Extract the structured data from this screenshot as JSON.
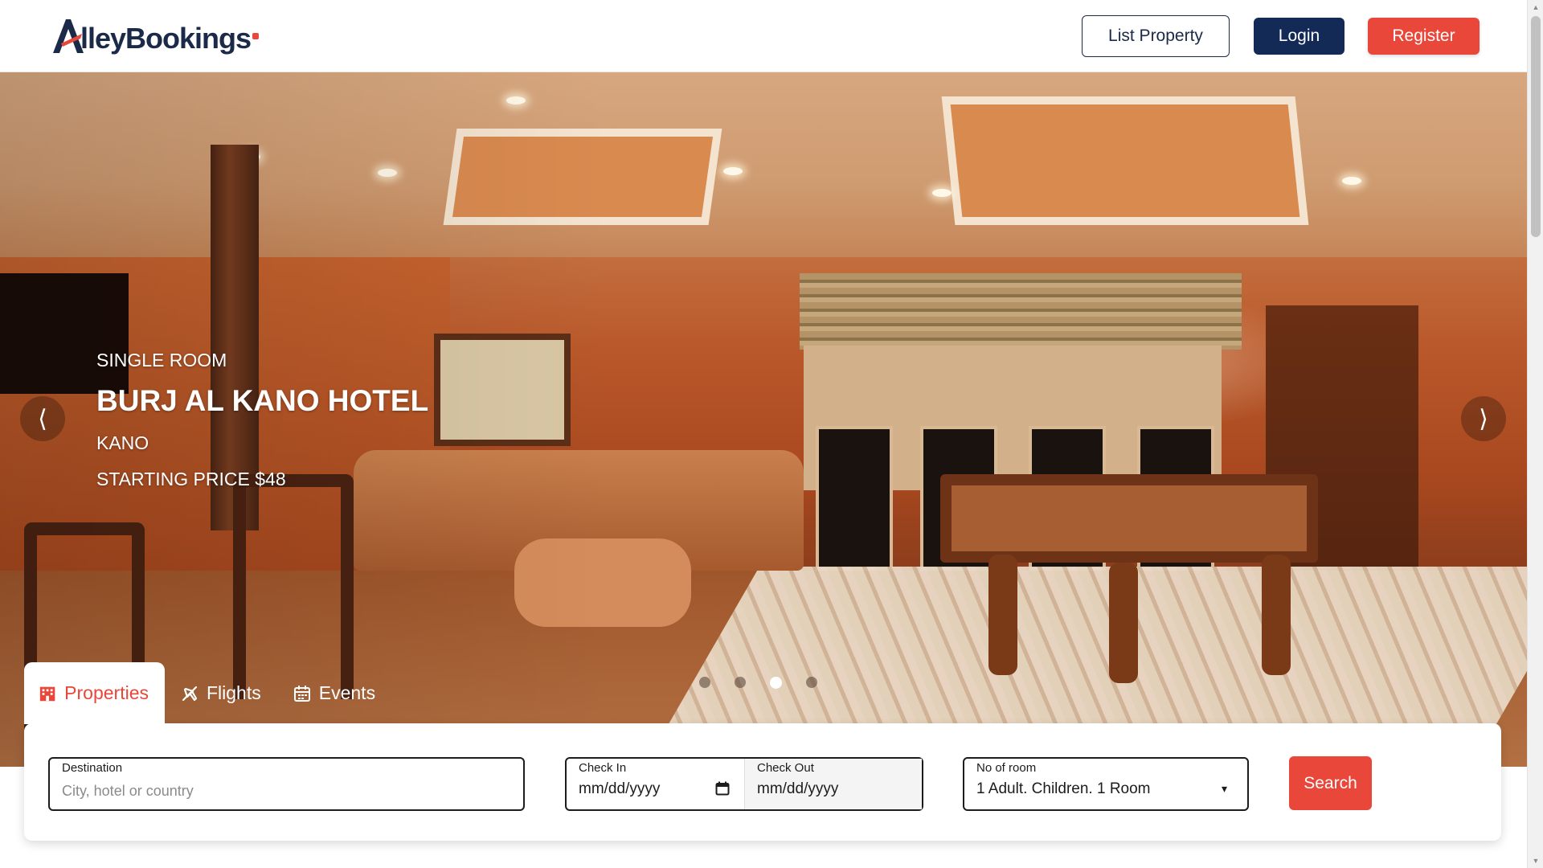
{
  "brand": {
    "logo_text": "AlleyBookings",
    "accent": "#e8473a",
    "navy": "#132a57"
  },
  "header": {
    "list_property": "List Property",
    "login": "Login",
    "register": "Register"
  },
  "hero": {
    "room_type": "SINGLE ROOM",
    "hotel_name": "BURJ AL KANO HOTEL",
    "city": "KANO",
    "price": "STARTING PRICE $48",
    "prev_icon": "chevron-left-icon",
    "next_icon": "chevron-right-icon",
    "slide_count": 4,
    "active_slide": 3
  },
  "tabs": [
    {
      "label": "Properties",
      "icon": "hotel-icon",
      "active": true
    },
    {
      "label": "Flights",
      "icon": "plane-icon",
      "active": false
    },
    {
      "label": "Events",
      "icon": "calendar-icon",
      "active": false
    }
  ],
  "search": {
    "destination_label": "Destination",
    "destination_placeholder": "City, hotel or country",
    "checkin_label": "Check In",
    "checkin_value": "mm/dd/yyyy",
    "checkout_label": "Check Out",
    "checkout_value": "mm/dd/yyyy",
    "rooms_label": "No of room",
    "rooms_value": "1 Adult. Children. 1 Room",
    "button": "Search"
  }
}
